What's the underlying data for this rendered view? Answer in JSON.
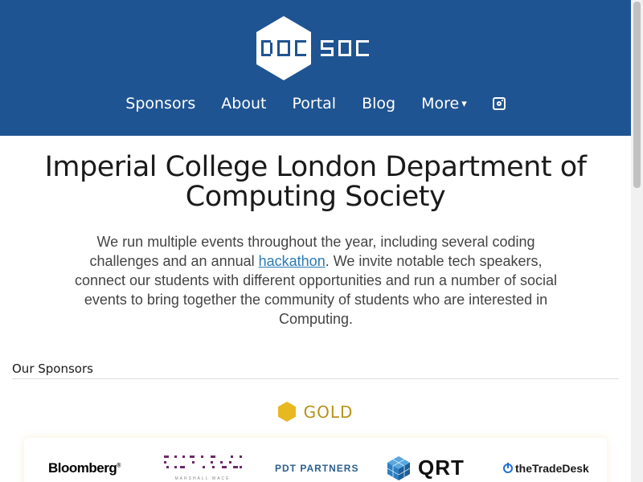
{
  "brand": {
    "logo_text": "DOCSOC"
  },
  "nav": {
    "items": [
      {
        "label": "Sponsors"
      },
      {
        "label": "About"
      },
      {
        "label": "Portal"
      },
      {
        "label": "Blog"
      },
      {
        "label": "More",
        "caret": "▾"
      }
    ],
    "social_icon": "instagram-icon"
  },
  "main": {
    "title": "Imperial College London Department of Computing Society",
    "intro_before": "We run multiple events throughout the year, including several coding challenges and an annual ",
    "intro_link": "hackathon",
    "intro_after": ". We invite notable tech speakers, connect our students with different opportunities and run a number of social events to bring together the community of students who are interested in Computing."
  },
  "sponsors": {
    "section_title": "Our Sponsors",
    "tier": {
      "label": "GOLD",
      "color": "#b8911a"
    },
    "logos": [
      {
        "name": "Bloomberg"
      },
      {
        "name": "Marshall Wace",
        "caption": "MARSHALL WACE"
      },
      {
        "name": "PDT PARTNERS"
      },
      {
        "name": "QRT"
      },
      {
        "name": "theTradeDesk"
      }
    ]
  },
  "colors": {
    "header_bg": "#1f5492",
    "link": "#2a7ab5",
    "gold": "#b8911a"
  }
}
